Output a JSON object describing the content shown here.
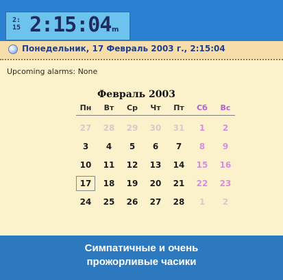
{
  "clock": {
    "icon_text_top": "2:",
    "icon_text_bottom": "15",
    "time": "2:15:04",
    "suffix": "m"
  },
  "date": {
    "bullet_icon": "date-bullet-icon",
    "text": "Понедельник, 17 Февраль 2003 г., 2:15:04"
  },
  "alarms": {
    "label": "Upcoming alarms:",
    "value": "None"
  },
  "calendar": {
    "month_label": "Февраль 2003",
    "weekdays": [
      {
        "label": "Пн",
        "weekend": false
      },
      {
        "label": "Вт",
        "weekend": false
      },
      {
        "label": "Ср",
        "weekend": false
      },
      {
        "label": "Чт",
        "weekend": false
      },
      {
        "label": "Пт",
        "weekend": false
      },
      {
        "label": "Сб",
        "weekend": true
      },
      {
        "label": "Вс",
        "weekend": true
      }
    ],
    "weeks": [
      [
        {
          "d": "27",
          "t": "dim"
        },
        {
          "d": "28",
          "t": "dim"
        },
        {
          "d": "29",
          "t": "dim"
        },
        {
          "d": "30",
          "t": "dim"
        },
        {
          "d": "31",
          "t": "dim"
        },
        {
          "d": "1",
          "t": "weekend"
        },
        {
          "d": "2",
          "t": "weekend"
        }
      ],
      [
        {
          "d": "3",
          "t": "normal"
        },
        {
          "d": "4",
          "t": "normal"
        },
        {
          "d": "5",
          "t": "normal"
        },
        {
          "d": "6",
          "t": "normal"
        },
        {
          "d": "7",
          "t": "normal"
        },
        {
          "d": "8",
          "t": "weekend"
        },
        {
          "d": "9",
          "t": "weekend"
        }
      ],
      [
        {
          "d": "10",
          "t": "normal"
        },
        {
          "d": "11",
          "t": "normal"
        },
        {
          "d": "12",
          "t": "normal"
        },
        {
          "d": "13",
          "t": "normal"
        },
        {
          "d": "14",
          "t": "normal"
        },
        {
          "d": "15",
          "t": "weekend"
        },
        {
          "d": "16",
          "t": "weekend"
        }
      ],
      [
        {
          "d": "17",
          "t": "selected"
        },
        {
          "d": "18",
          "t": "normal"
        },
        {
          "d": "19",
          "t": "normal"
        },
        {
          "d": "20",
          "t": "normal"
        },
        {
          "d": "21",
          "t": "normal"
        },
        {
          "d": "22",
          "t": "weekend"
        },
        {
          "d": "23",
          "t": "weekend"
        }
      ],
      [
        {
          "d": "24",
          "t": "normal"
        },
        {
          "d": "25",
          "t": "normal"
        },
        {
          "d": "26",
          "t": "normal"
        },
        {
          "d": "27",
          "t": "normal"
        },
        {
          "d": "28",
          "t": "normal"
        },
        {
          "d": "1",
          "t": "dim"
        },
        {
          "d": "2",
          "t": "dim"
        }
      ]
    ]
  },
  "caption": {
    "line1": "Симпатичные и очень",
    "line2": "прожорливые часики"
  }
}
